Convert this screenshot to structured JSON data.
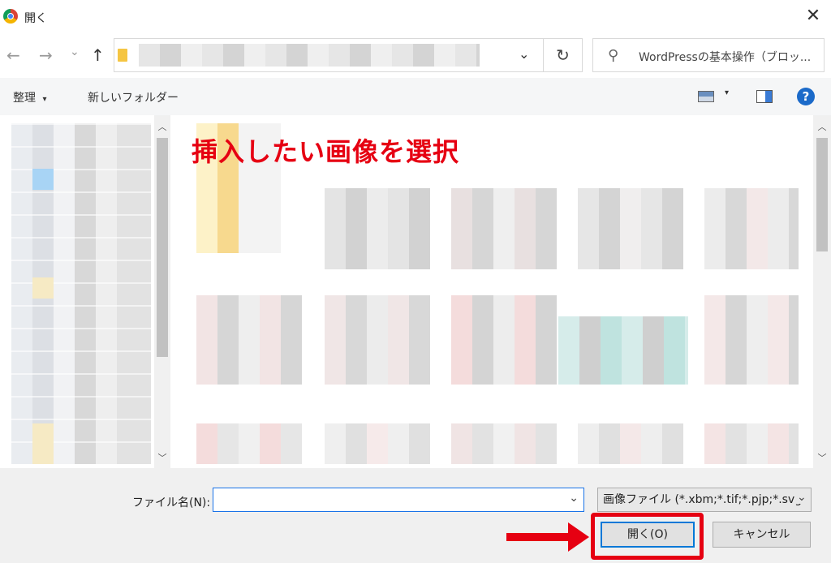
{
  "window": {
    "title": "開く",
    "close_symbol": "✕"
  },
  "nav": {
    "back": "←",
    "forward": "→",
    "recent": "⌄",
    "up": "↑",
    "refresh": "↻",
    "address_dropdown": "⌄"
  },
  "search": {
    "placeholder": "WordPressの基本操作（ブロッ...",
    "icon": "⚲"
  },
  "toolbar": {
    "organize": "整理",
    "organize_caret": "▾",
    "new_folder": "新しいフォルダー",
    "view_caret": "▾",
    "help": "?"
  },
  "overlay_caption": "挿入したい画像を選択",
  "filename": {
    "label": "ファイル名(N):",
    "value": "",
    "dropdown": "⌄"
  },
  "filetype": {
    "selected": "画像ファイル (*.xbm;*.tif;*.pjp;*.svg",
    "dropdown": "⌄"
  },
  "buttons": {
    "open": "開く(O)",
    "cancel": "キャンセル"
  },
  "scroll": {
    "up": "︿",
    "down": "﹀"
  },
  "colors": {
    "highlight_red": "#e60012",
    "help_blue": "#1b6ac9",
    "focus_blue": "#1a73e8"
  }
}
